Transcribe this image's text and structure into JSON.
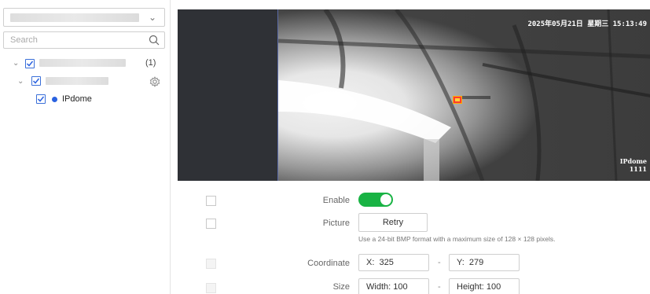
{
  "sidebar": {
    "search": {
      "placeholder": "Search"
    },
    "tree": {
      "root_count": "(1)",
      "device": {
        "name": "IPdome",
        "status_color": "#2a62e0"
      }
    }
  },
  "video": {
    "osd_datetime": "2025年05月21日 星期三 15:13:49",
    "osd_channel_name": "IPdome",
    "osd_channel_number": "1111"
  },
  "form": {
    "enable": {
      "label": "Enable",
      "on": true,
      "color": "#19b344"
    },
    "picture": {
      "label": "Picture",
      "retry_label": "Retry",
      "hint": "Use a 24-bit BMP format with a maximum size of 128 × 128 pixels."
    },
    "coordinate": {
      "label": "Coordinate",
      "x": "X:  325",
      "y": "Y:  279"
    },
    "size": {
      "label": "Size",
      "width": "Width: 100",
      "height": "Height: 100"
    },
    "separator": "-"
  },
  "icons": {
    "dropdown": "chevron-down-icon",
    "search": "search-icon",
    "tree_caret": "chevron-down-icon",
    "settings": "gear-icon",
    "checkbox": "checkmark-icon"
  }
}
